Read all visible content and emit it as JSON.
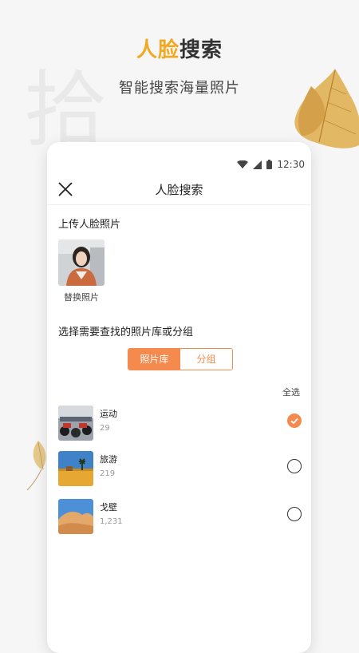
{
  "hero": {
    "title_accent": "人脸",
    "title_rest": "搜索",
    "subtitle": "智能搜索海量照片",
    "bg_glyph": "拾"
  },
  "status_bar": {
    "time": "12:30",
    "icons": [
      "wifi-icon",
      "signal-icon",
      "battery-icon"
    ]
  },
  "nav": {
    "title": "人脸搜索",
    "close_icon": "close-icon"
  },
  "upload": {
    "section_label": "上传人脸照片",
    "replace_label": "替换照片"
  },
  "library": {
    "section_label": "选择需要查找的照片库或分组",
    "tabs": [
      {
        "label": "照片库",
        "active": true
      },
      {
        "label": "分组",
        "active": false
      }
    ],
    "select_all": "全选",
    "albums": [
      {
        "name": "运动",
        "count": "29",
        "selected": true
      },
      {
        "name": "旅游",
        "count": "219",
        "selected": false
      },
      {
        "name": "戈壁",
        "count": "1,231",
        "selected": false
      }
    ]
  },
  "colors": {
    "accent_orange": "#f58a4e",
    "title_yellow": "#f2a922"
  }
}
